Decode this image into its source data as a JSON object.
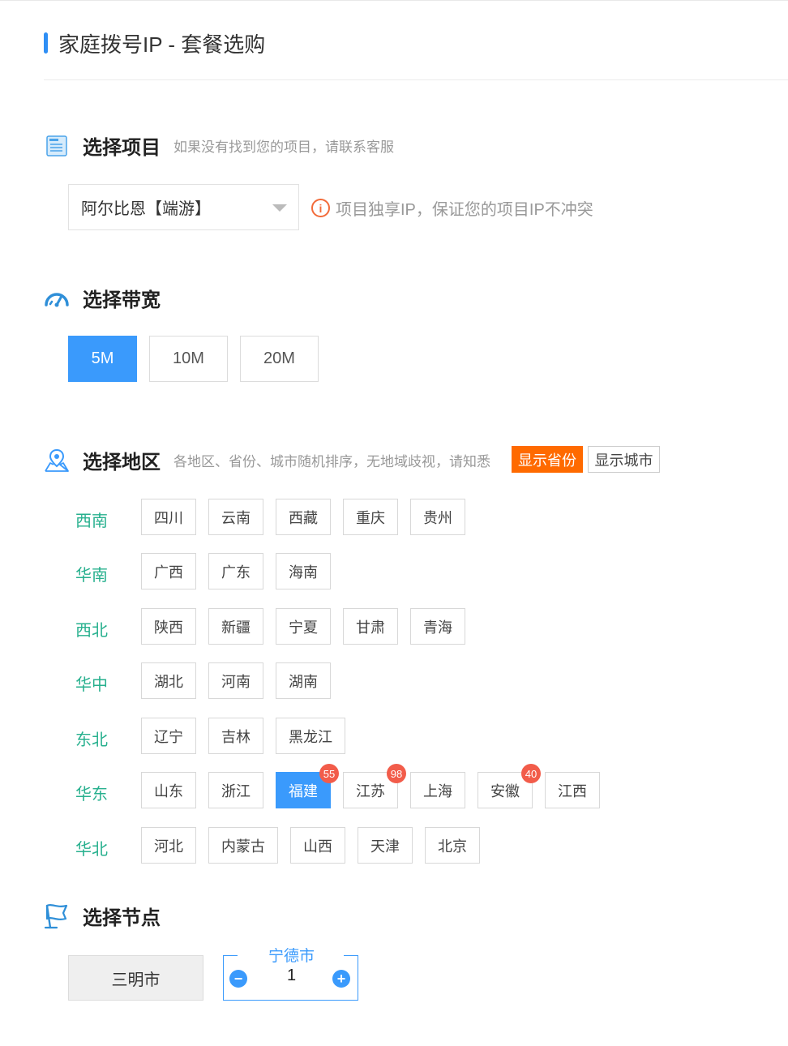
{
  "header": {
    "title": "家庭拨号IP - 套餐选购"
  },
  "project": {
    "label": "选择项目",
    "hint": "如果没有找到您的项目，请联系客服",
    "selected": "阿尔比恩【端游】",
    "notice": "项目独享IP，保证您的项目IP不冲突",
    "notice_icon": "i"
  },
  "bandwidth": {
    "label": "选择带宽",
    "options": [
      "5M",
      "10M",
      "20M"
    ],
    "selected": "5M"
  },
  "region": {
    "label": "选择地区",
    "hint": "各地区、省份、城市随机排序，无地域歧视，请知悉",
    "show_province": "显示省份",
    "show_city": "显示城市",
    "groups": [
      {
        "name": "西南",
        "provinces": [
          "四川",
          "云南",
          "西藏",
          "重庆",
          "贵州"
        ]
      },
      {
        "name": "华南",
        "provinces": [
          "广西",
          "广东",
          "海南"
        ]
      },
      {
        "name": "西北",
        "provinces": [
          "陕西",
          "新疆",
          "宁夏",
          "甘肃",
          "青海"
        ]
      },
      {
        "name": "华中",
        "provinces": [
          "湖北",
          "河南",
          "湖南"
        ]
      },
      {
        "name": "东北",
        "provinces": [
          "辽宁",
          "吉林",
          "黑龙江"
        ]
      },
      {
        "name": "华东",
        "provinces": [
          "山东",
          "浙江",
          "福建",
          "江苏",
          "上海",
          "安徽",
          "江西"
        ]
      },
      {
        "name": "华北",
        "provinces": [
          "河北",
          "内蒙古",
          "山西",
          "天津",
          "北京"
        ]
      }
    ],
    "badges": {
      "福建": "55",
      "江苏": "98",
      "安徽": "40"
    },
    "selected_province": "福建"
  },
  "node": {
    "label": "选择节点",
    "city_a": "三明市",
    "city_b": "宁德市",
    "quantity": "1",
    "minus": "−",
    "plus": "+"
  },
  "colors": {
    "accent": "#3a9afc",
    "region_text": "#27b08e",
    "toggle_active": "#ff6a00",
    "badge": "#f25c4a"
  }
}
